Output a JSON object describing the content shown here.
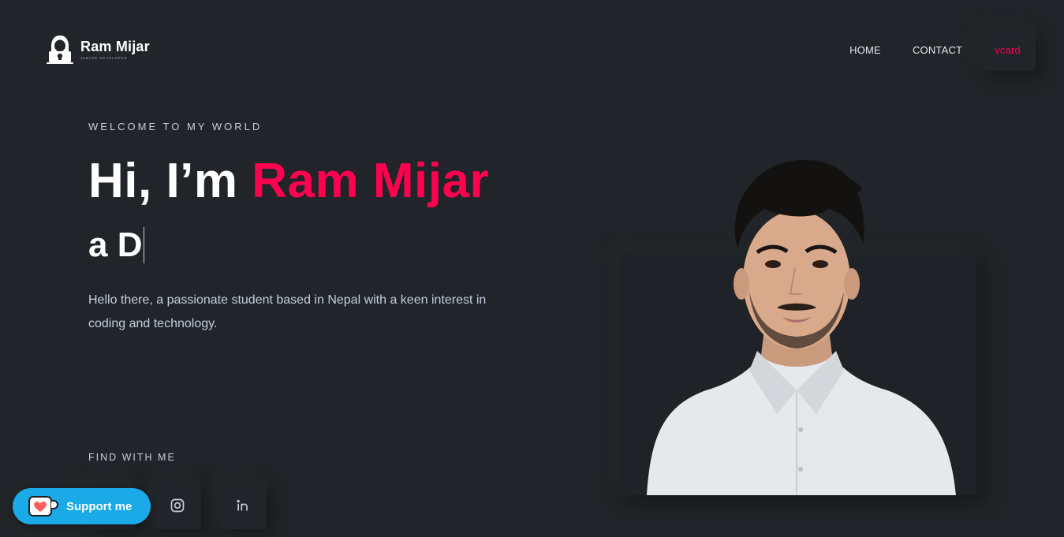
{
  "header": {
    "logo_name": "Ram Mijar",
    "logo_sub": "Junior Developer",
    "nav": [
      {
        "label": "HOME"
      },
      {
        "label": "CONTACT"
      },
      {
        "label": "vcard"
      }
    ]
  },
  "hero": {
    "welcome": "WELCOME TO MY WORLD",
    "title_prefix": "Hi, I’m ",
    "title_name": "Ram Mijar",
    "typing_text": "a D",
    "intro": "Hello there, a passionate student based in Nepal with a keen interest in coding and technology."
  },
  "social": {
    "heading": "FIND WITH ME",
    "icons": [
      "instagram-icon",
      "linkedin-icon"
    ]
  },
  "support": {
    "label": "Support me"
  },
  "colors": {
    "background": "#212428",
    "accent": "#ff014f",
    "text": "#c4cfde",
    "support_button": "#1aaae7"
  }
}
